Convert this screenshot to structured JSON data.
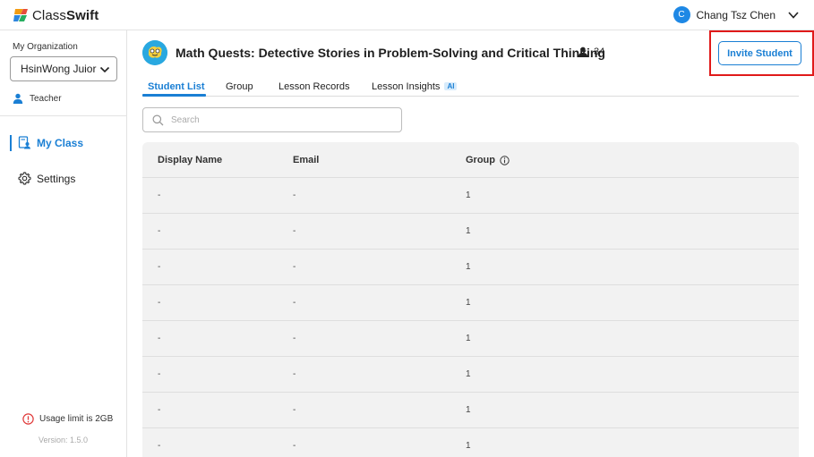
{
  "header": {
    "logo_light": "Class",
    "logo_bold": "Swift",
    "user_initial": "C",
    "user_name": "Chang Tsz Chen"
  },
  "sidebar": {
    "org_label": "My Organization",
    "org_value": "HsinWong Juior High School",
    "role": "Teacher",
    "nav": [
      {
        "label": "My Class",
        "icon": "class-roster-icon",
        "active": true
      },
      {
        "label": "Settings",
        "icon": "gear-icon",
        "active": false
      }
    ],
    "usage": "Usage limit is 2GB",
    "version": "Version: 1.5.0"
  },
  "class": {
    "title": "Math Quests: Detective Stories in Problem-Solving and Critical Thinking",
    "student_count": "34",
    "invite_label": "Invite Student"
  },
  "tabs": [
    {
      "label": "Student List",
      "active": true
    },
    {
      "label": "Group",
      "active": false
    },
    {
      "label": "Lesson Records",
      "active": false
    },
    {
      "label": "Lesson Insights",
      "active": false,
      "badge": "AI"
    }
  ],
  "search": {
    "placeholder": "Search"
  },
  "table": {
    "columns": [
      "Display Name",
      "Email",
      "Group"
    ],
    "rows": [
      [
        "-",
        "-",
        "1"
      ],
      [
        "-",
        "-",
        "1"
      ],
      [
        "-",
        "-",
        "1"
      ],
      [
        "-",
        "-",
        "1"
      ],
      [
        "-",
        "-",
        "1"
      ],
      [
        "-",
        "-",
        "1"
      ],
      [
        "-",
        "-",
        "1"
      ],
      [
        "-",
        "-",
        "1"
      ]
    ]
  },
  "colors": {
    "accent": "#1a7fd4",
    "highlight": "#e01a1a",
    "table_bg": "#f2f2f2"
  }
}
